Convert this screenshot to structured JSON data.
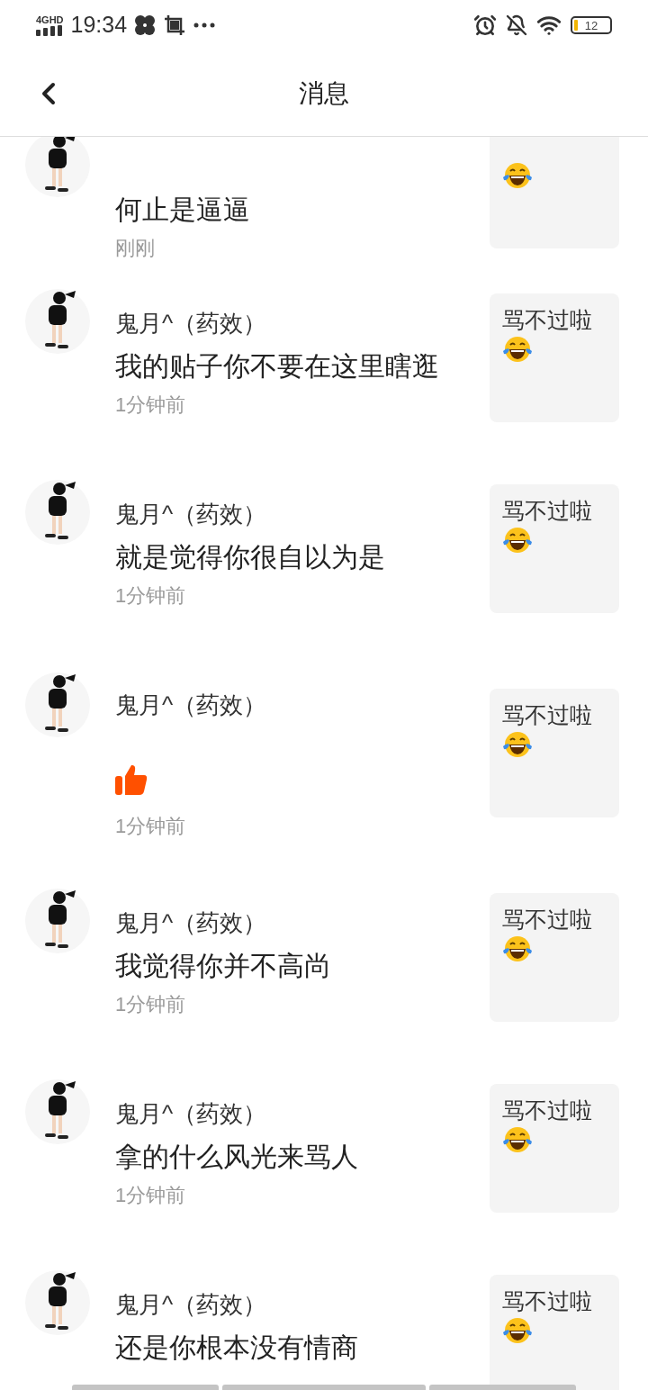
{
  "status_bar": {
    "network": "4GHD",
    "time": "19:34",
    "battery": "12"
  },
  "header": {
    "title": "消息"
  },
  "items": [
    {
      "kind": "text",
      "clipped": true,
      "message": "何止是逼逼",
      "time": "刚刚"
    },
    {
      "kind": "text",
      "name": "鬼月^（药效）",
      "message": "我的贴子你不要在这里瞎逛",
      "time": "1分钟前",
      "quote": {
        "text": "骂不过啦"
      }
    },
    {
      "kind": "text",
      "name": "鬼月^（药效）",
      "message": "就是觉得你很自以为是",
      "time": "1分钟前",
      "quote": {
        "text": "骂不过啦"
      }
    },
    {
      "kind": "like",
      "name": "鬼月^（药效）",
      "time": "1分钟前",
      "quote": {
        "text": "骂不过啦"
      }
    },
    {
      "kind": "text",
      "name": "鬼月^（药效）",
      "message": "我觉得你并不高尚",
      "time": "1分钟前",
      "quote": {
        "text": "骂不过啦"
      }
    },
    {
      "kind": "text",
      "name": "鬼月^（药效）",
      "message": "拿的什么风光来骂人",
      "time": "1分钟前",
      "quote": {
        "text": "骂不过啦"
      }
    },
    {
      "kind": "text",
      "name": "鬼月^（药效）",
      "message": "还是你根本没有情商",
      "quote": {
        "text": "骂不过啦"
      }
    }
  ]
}
